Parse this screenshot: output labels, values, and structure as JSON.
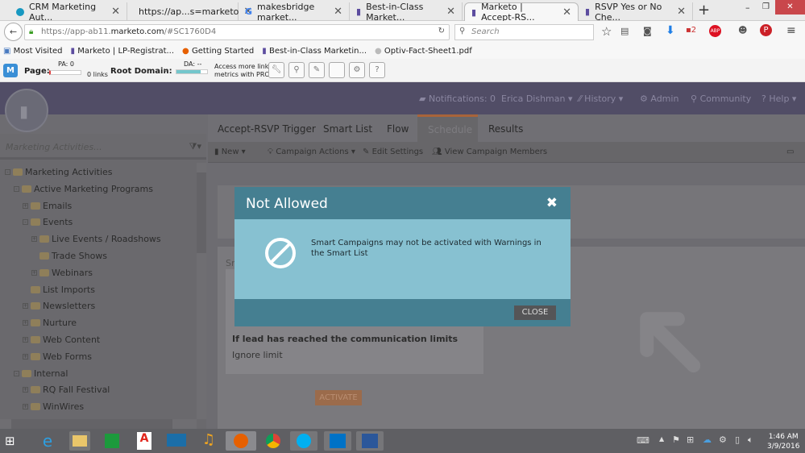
{
  "browser": {
    "tabs": [
      {
        "label": "CRM Marketing Aut...",
        "icon": "salesforce-cloud-icon"
      },
      {
        "label": "https://ap...s=marketo",
        "icon": "salesforce-cloud-icon"
      },
      {
        "label": "makesbridge market...",
        "icon": "google-icon"
      },
      {
        "label": "Best-in-Class Market...",
        "icon": "marketo-icon"
      },
      {
        "label": "Marketo | Accept-RS...",
        "icon": "marketo-icon",
        "active": true
      },
      {
        "label": "RSVP Yes or No Che...",
        "icon": "marketo-icon"
      }
    ],
    "url_prefix": "https://app-ab11.",
    "url_domain": "marketo.com",
    "url_suffix": "/#SC1760D4",
    "search_placeholder": "Search",
    "bookmarks": [
      "Most Visited",
      "Marketo | LP-Registrat...",
      "Getting Started",
      "Best-in-Class Marketin...",
      "Optiv-Fact-Sheet1.pdf"
    ]
  },
  "mozbar": {
    "page_label": "Page:",
    "pa": "PA: 0",
    "links": "0 links",
    "root_label": "Root Domain:",
    "da": "DA: --",
    "pro_line1": "Access more link",
    "pro_line2": "metrics with PRO",
    "da_fill_percent": 80
  },
  "app": {
    "header": {
      "notifications": "Notifications: 0",
      "user": "Erica Dishman",
      "history": "History",
      "admin": "Admin",
      "community": "Community",
      "help": "Help"
    },
    "tabs": [
      "Accept-RSVP Trigger",
      "Smart List",
      "Flow",
      "Schedule",
      "Results"
    ],
    "active_tab": "Schedule",
    "toolbar": {
      "new": "New",
      "campaign_actions": "Campaign Actions",
      "edit_settings": "Edit Settings",
      "view_members": "View Campaign Members"
    },
    "tree_search_placeholder": "Marketing Activities...",
    "tree": [
      {
        "label": "Marketing Activities",
        "level": 0,
        "toggle": "-"
      },
      {
        "label": "Active Marketing Programs",
        "level": 1,
        "toggle": "-"
      },
      {
        "label": "Emails",
        "level": 2,
        "toggle": "+"
      },
      {
        "label": "Events",
        "level": 2,
        "toggle": "-"
      },
      {
        "label": "Live Events / Roadshows",
        "level": 3,
        "toggle": "+"
      },
      {
        "label": "Trade Shows",
        "level": 3,
        "toggle": ""
      },
      {
        "label": "Webinars",
        "level": 3,
        "toggle": "+"
      },
      {
        "label": "List Imports",
        "level": 2,
        "toggle": ""
      },
      {
        "label": "Newsletters",
        "level": 2,
        "toggle": "+"
      },
      {
        "label": "Nurture",
        "level": 2,
        "toggle": "+"
      },
      {
        "label": "Web Content",
        "level": 2,
        "toggle": "+"
      },
      {
        "label": "Web Forms",
        "level": 2,
        "toggle": "+"
      },
      {
        "label": "Internal",
        "level": 1,
        "toggle": "-"
      },
      {
        "label": "RQ Fall Festival",
        "level": 2,
        "toggle": "+"
      },
      {
        "label": "WinWires",
        "level": 2,
        "toggle": "+"
      }
    ],
    "content": {
      "partial_label": "Sm",
      "comm_limit_heading": "If lead has reached the communication limits",
      "comm_limit_value": "Ignore limit",
      "activate": "ACTIVATE"
    }
  },
  "modal": {
    "title": "Not Allowed",
    "message": "Smart Campaigns may not be activated with Warnings in the Smart List",
    "close": "CLOSE",
    "icon": "prohibited-icon"
  },
  "taskbar": {
    "time": "1:46 AM",
    "date": "3/9/2016"
  }
}
